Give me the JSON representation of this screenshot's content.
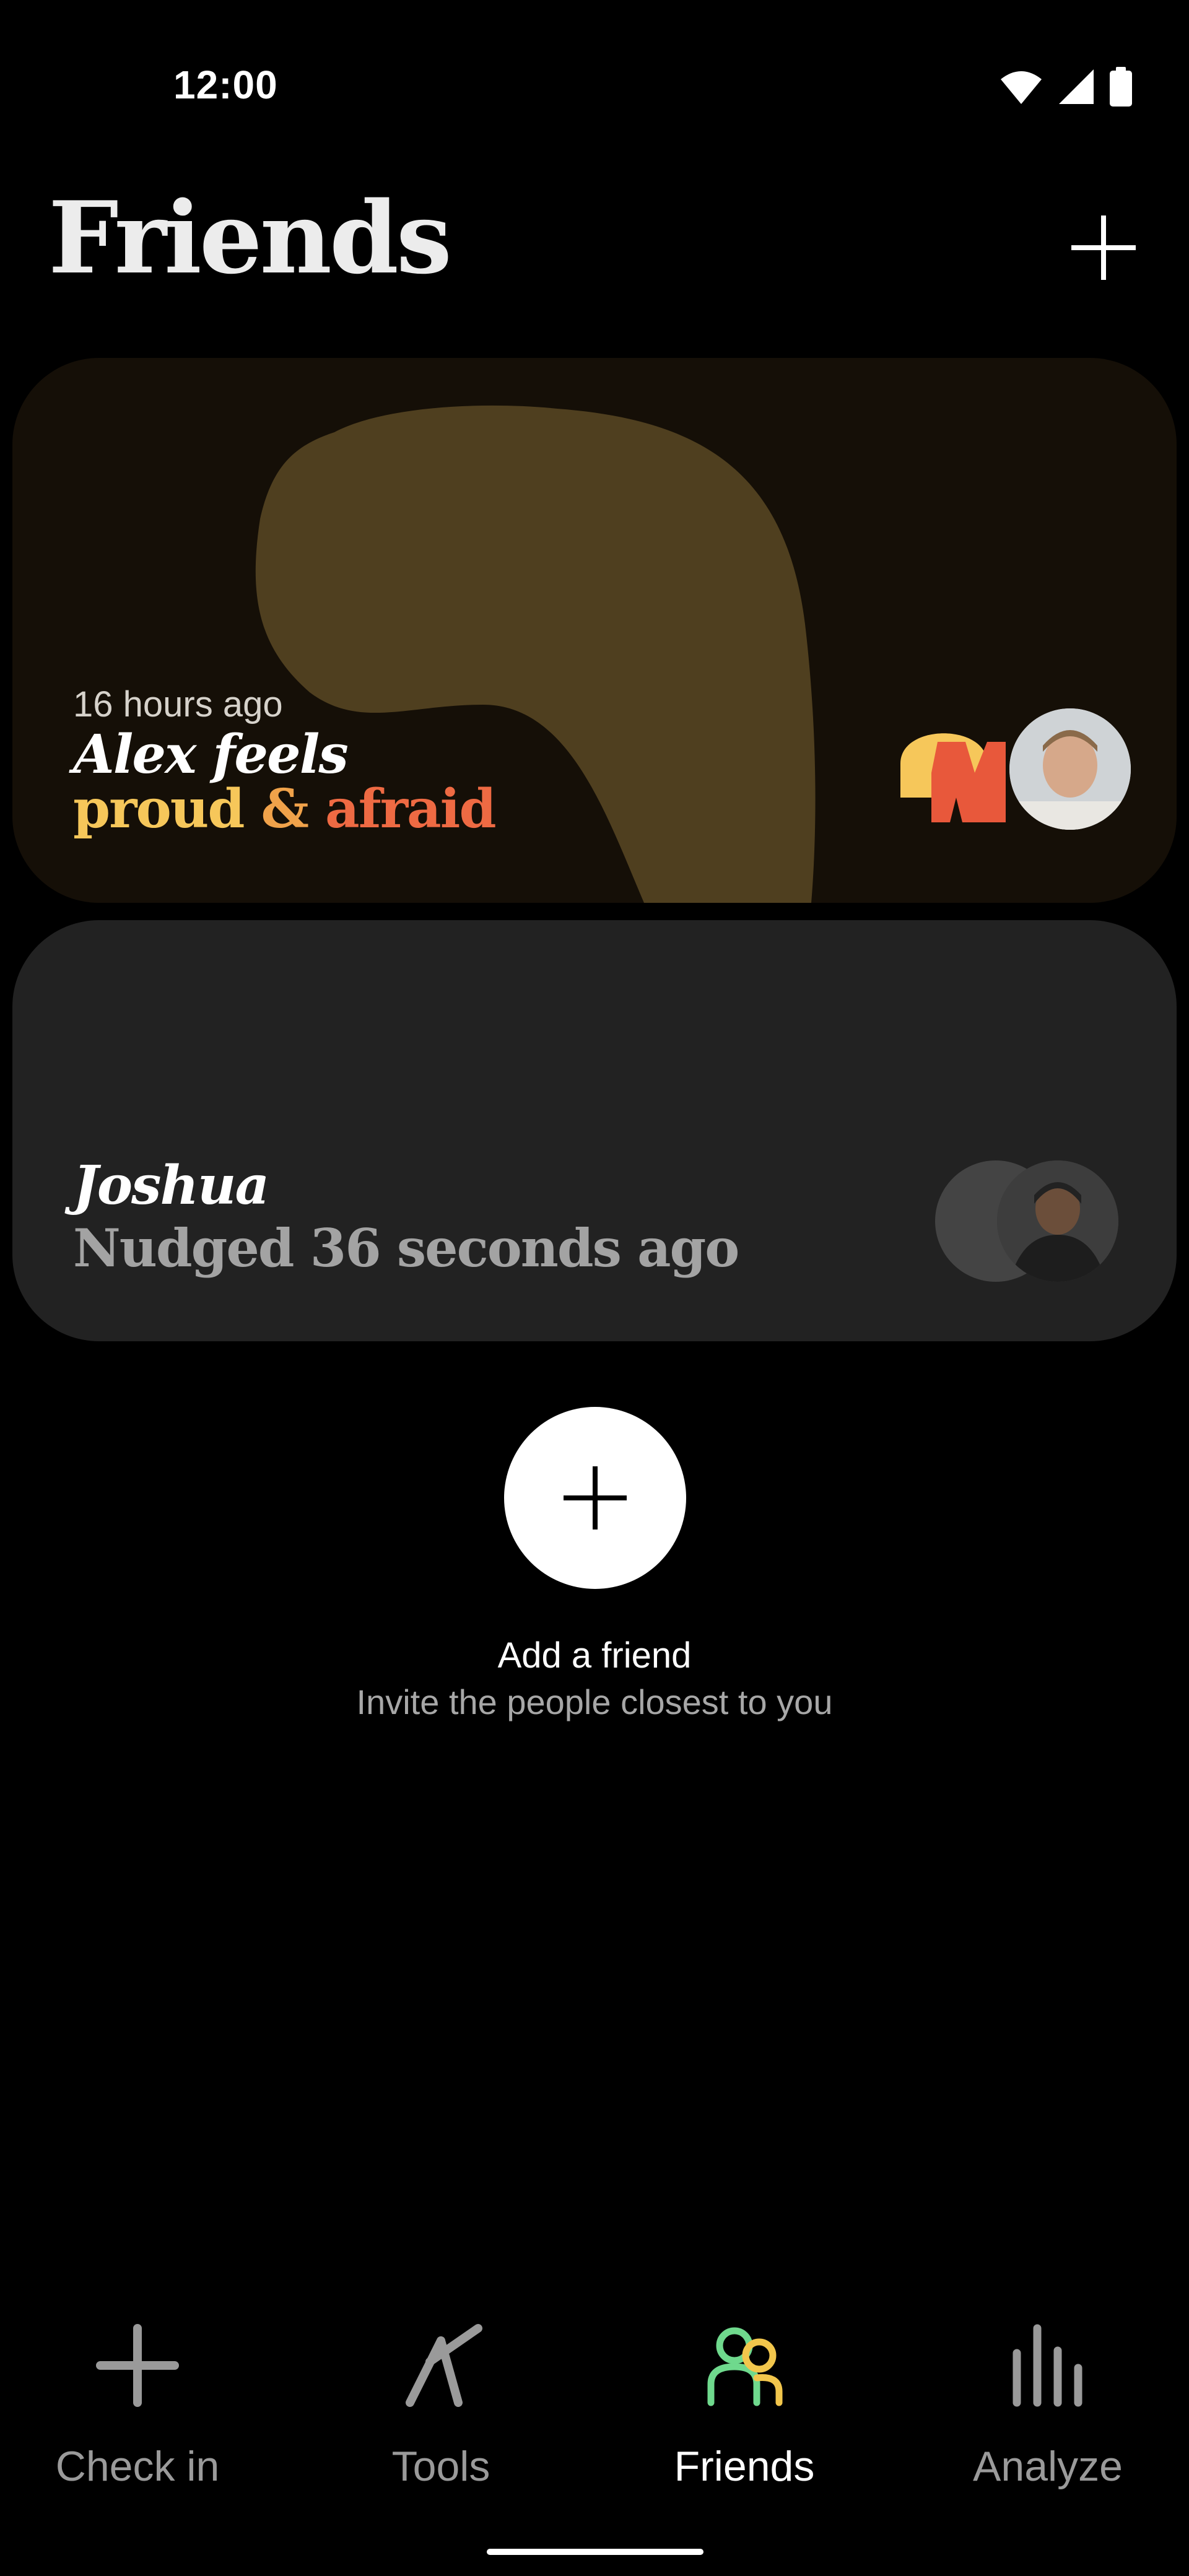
{
  "status_bar": {
    "time": "12:00"
  },
  "header": {
    "title": "Friends"
  },
  "cards": {
    "alex": {
      "time_ago": "16 hours ago",
      "feels_line": "Alex feels",
      "mood_1": "proud",
      "connector": "&",
      "mood_2": "afraid",
      "colors": {
        "background": "#150f07",
        "blob": "#4f3f1f",
        "mood_1": "#f6c75a",
        "mood_2": "#ee6a43"
      }
    },
    "joshua": {
      "name": "Joshua",
      "status": "Nudged 36 seconds ago",
      "colors": {
        "background": "#222222"
      }
    }
  },
  "add_friend": {
    "title": "Add a friend",
    "subtitle": "Invite the people closest to you"
  },
  "nav": {
    "items": [
      {
        "label": "Check in",
        "icon": "plus-icon",
        "active": false
      },
      {
        "label": "Tools",
        "icon": "tools-icon",
        "active": false
      },
      {
        "label": "Friends",
        "icon": "friends-icon",
        "active": true
      },
      {
        "label": "Analyze",
        "icon": "bar-chart-icon",
        "active": false
      }
    ],
    "active_color_1": "#6fd98d",
    "active_color_2": "#f2c64c"
  }
}
